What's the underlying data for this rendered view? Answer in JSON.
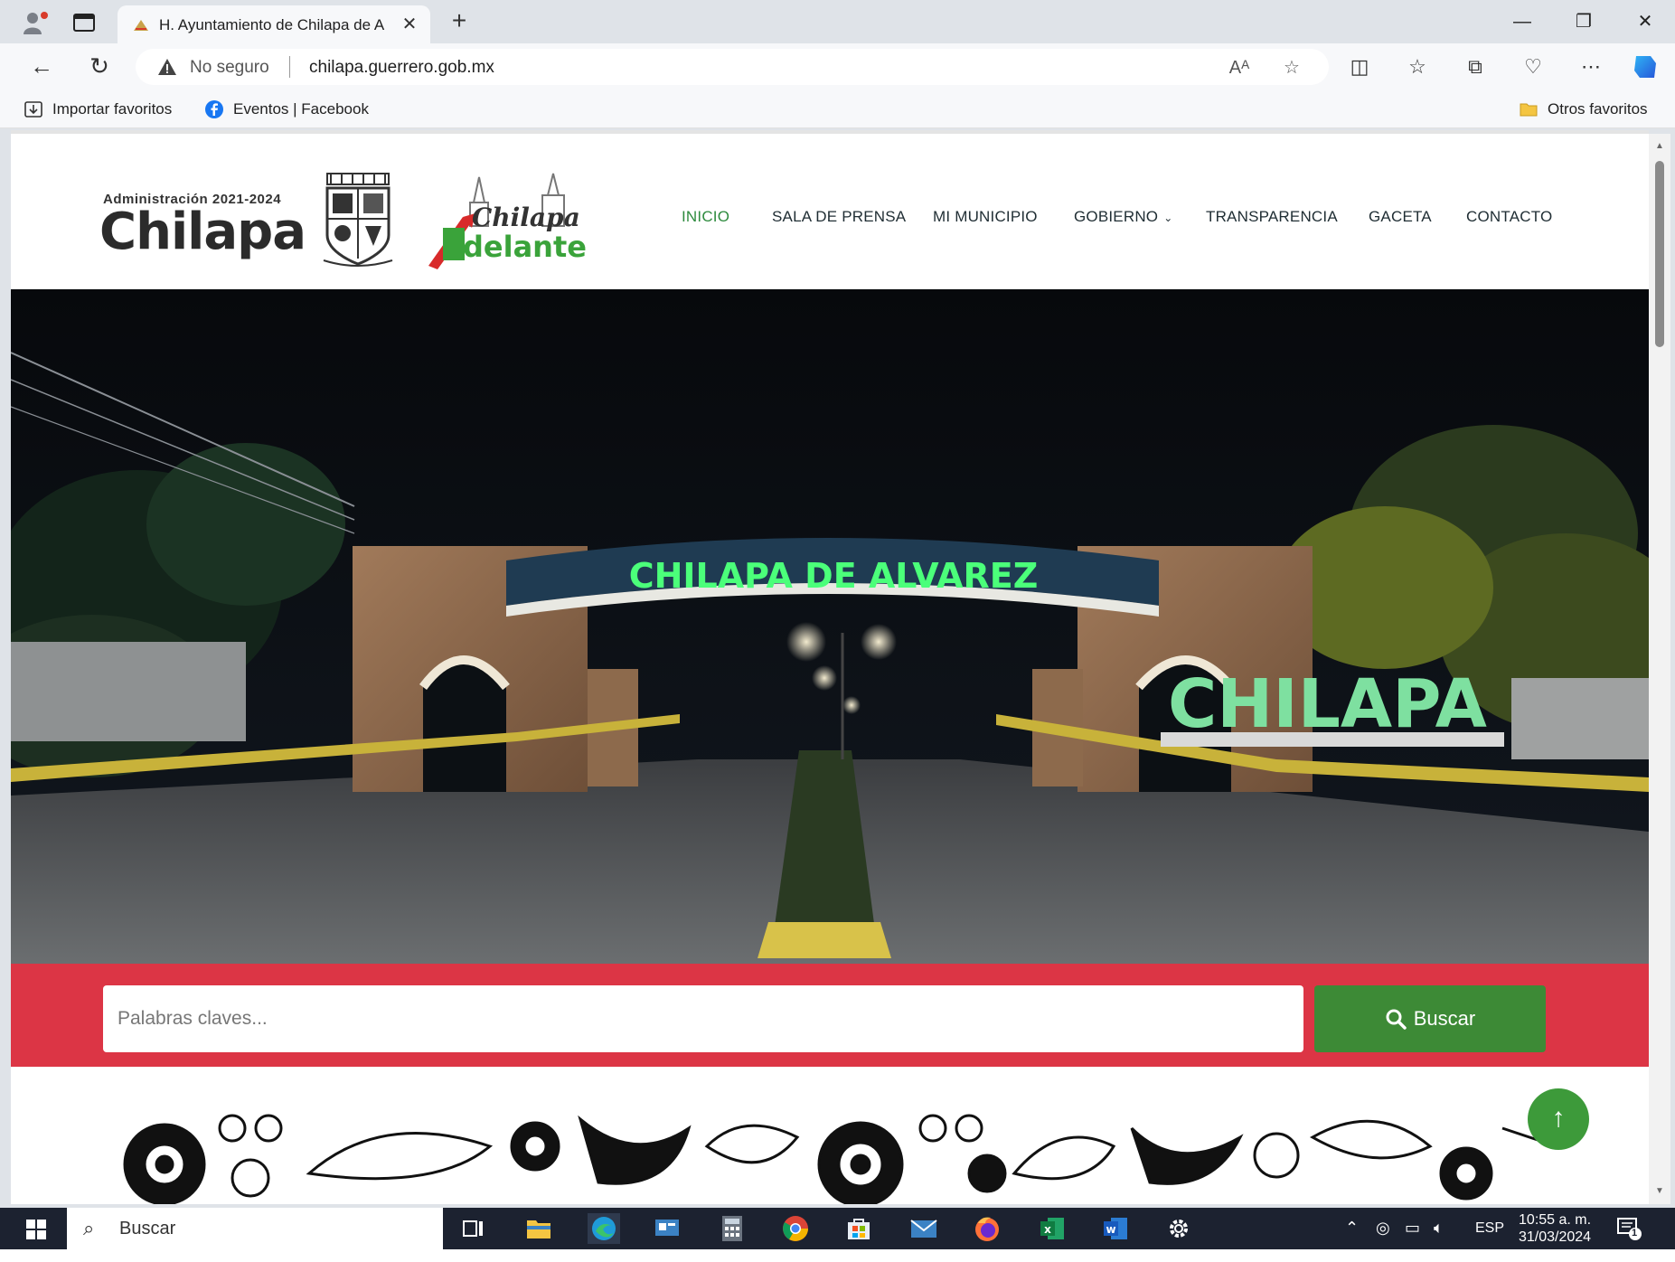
{
  "browser": {
    "tab_title": "H. Ayuntamiento de Chilapa de A",
    "tab_close": "✕",
    "new_tab": "+",
    "security_label": "No seguro",
    "url": "chilapa.guerrero.gob.mx",
    "favorites": [
      {
        "label": "Importar favoritos",
        "icon": "import-icon"
      },
      {
        "label": "Eventos | Facebook",
        "icon": "facebook-icon"
      }
    ],
    "other_favorites": "Otros favoritos"
  },
  "site": {
    "logo": {
      "admin": "Administración 2021-2024",
      "name": "Chilapa",
      "slogan_top": "Chilapa",
      "slogan_bottom": "delante"
    },
    "nav": [
      {
        "label": "INICIO",
        "active": true
      },
      {
        "label": "SALA DE PRENSA"
      },
      {
        "label": "MI MUNICIPIO"
      },
      {
        "label": "GOBIERNO",
        "has_dropdown": true
      },
      {
        "label": "TRANSPARENCIA"
      },
      {
        "label": "GACETA"
      },
      {
        "label": "CONTACTO"
      }
    ],
    "hero": {
      "arch_sign": "CHILAPA DE ALVAREZ",
      "letters_sign": "CHILAPA"
    },
    "search": {
      "placeholder": "Palabras claves...",
      "button": "Buscar"
    },
    "back_to_top": "↑"
  },
  "taskbar": {
    "search_text": "Buscar",
    "lang": "ESP",
    "time": "10:55 a. m.",
    "date": "31/03/2024",
    "notification_count": "1"
  },
  "colors": {
    "accent_green": "#3d8a36",
    "search_band": "#dc3545",
    "nav_active": "#2e8b3e"
  }
}
